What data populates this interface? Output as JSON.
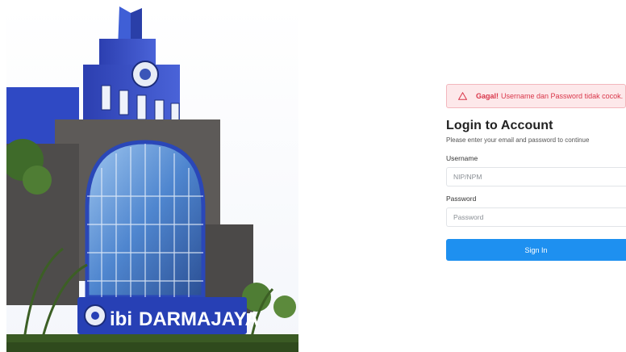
{
  "hero": {
    "sign_text": "DARMAJAYA",
    "sign_logo_text": "ibi"
  },
  "alert": {
    "icon": "warning-triangle-icon",
    "strong": "Gagal!",
    "message": "Username dan Password tidak cocok."
  },
  "login": {
    "title": "Login to Account",
    "subtitle": "Please enter your email and password to continue",
    "username_label": "Username",
    "username_placeholder": "NIP/NPM",
    "password_label": "Password",
    "password_placeholder": "Password",
    "submit_label": "Sign In"
  },
  "colors": {
    "primary": "#1e90f0",
    "alert_bg": "#fde8ea",
    "alert_text": "#d9364a"
  }
}
